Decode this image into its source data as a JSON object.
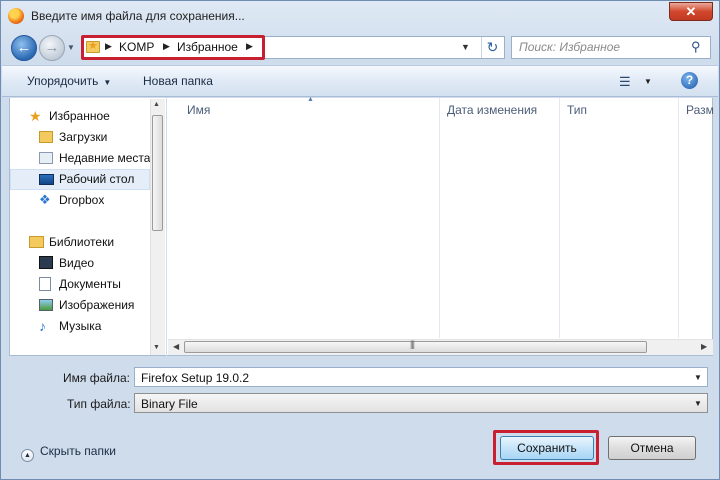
{
  "window": {
    "title": "Введите имя файла для сохранения...",
    "close_label": "✕"
  },
  "address": {
    "breadcrumbs": [
      "KOMP",
      "Избранное"
    ],
    "dropdown_glyph": "▼",
    "refresh_glyph": "↻"
  },
  "search": {
    "placeholder": "Поиск: Избранное"
  },
  "toolbar": {
    "organize_label": "Упорядочить",
    "new_folder_label": "Новая папка",
    "help_label": "?"
  },
  "sidebar": {
    "items": [
      {
        "label": "Избранное",
        "icon": "star-icon"
      },
      {
        "label": "Загрузки",
        "icon": "downloads-icon"
      },
      {
        "label": "Недавние места",
        "icon": "recent-places-icon"
      },
      {
        "label": "Рабочий стол",
        "icon": "desktop-icon",
        "selected": true
      },
      {
        "label": "Dropbox",
        "icon": "dropbox-icon"
      },
      {
        "label": "Библиотеки",
        "icon": "libraries-icon"
      },
      {
        "label": "Видео",
        "icon": "video-icon"
      },
      {
        "label": "Документы",
        "icon": "documents-icon"
      },
      {
        "label": "Изображения",
        "icon": "pictures-icon"
      },
      {
        "label": "Музыка",
        "icon": "music-icon"
      }
    ]
  },
  "filelist": {
    "columns": [
      "Имя",
      "Дата изменения",
      "Тип",
      "Разм"
    ]
  },
  "form": {
    "filename_label": "Имя файла:",
    "filename_value": "Firefox Setup 19.0.2",
    "filetype_label": "Тип файла:",
    "filetype_value": "Binary File"
  },
  "footer": {
    "hide_folders_label": "Скрыть папки",
    "save_label": "Сохранить",
    "cancel_label": "Отмена"
  },
  "colors": {
    "highlight": "#c82030",
    "accent": "#2a69b3"
  }
}
